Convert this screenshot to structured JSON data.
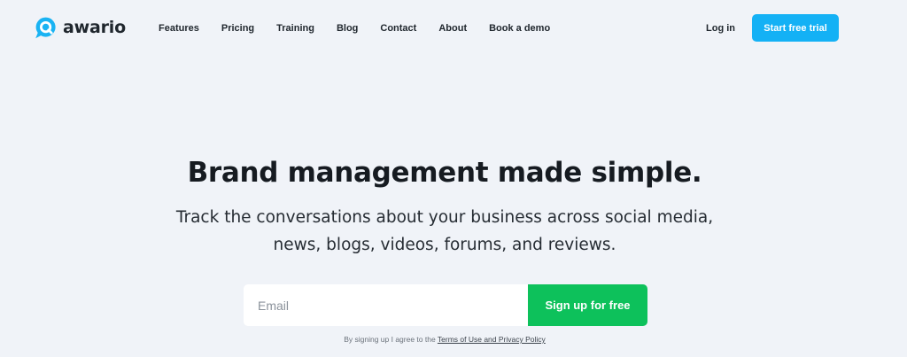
{
  "brand": {
    "name": "awario",
    "logo_icon": "chat-bubble-search-icon",
    "accent_color": "#14b1f5"
  },
  "nav": {
    "items": [
      {
        "label": "Features"
      },
      {
        "label": "Pricing"
      },
      {
        "label": "Training"
      },
      {
        "label": "Blog"
      },
      {
        "label": "Contact"
      },
      {
        "label": "About"
      },
      {
        "label": "Book a demo"
      }
    ],
    "login_label": "Log in",
    "trial_label": "Start free trial"
  },
  "hero": {
    "title": "Brand management made simple.",
    "subtitle_line1": "Track the conversations about your business across social media,",
    "subtitle_line2": "news, blogs, videos, forums, and reviews."
  },
  "signup": {
    "email_placeholder": "Email",
    "email_value": "",
    "button_label": "Sign up for free",
    "button_color": "#0dc15b",
    "terms_prefix": "By signing up I agree to the ",
    "terms_link": "Terms of Use and Privacy Policy"
  },
  "colors": {
    "page_background": "#f0f3f8",
    "text_dark": "#1f262d"
  }
}
